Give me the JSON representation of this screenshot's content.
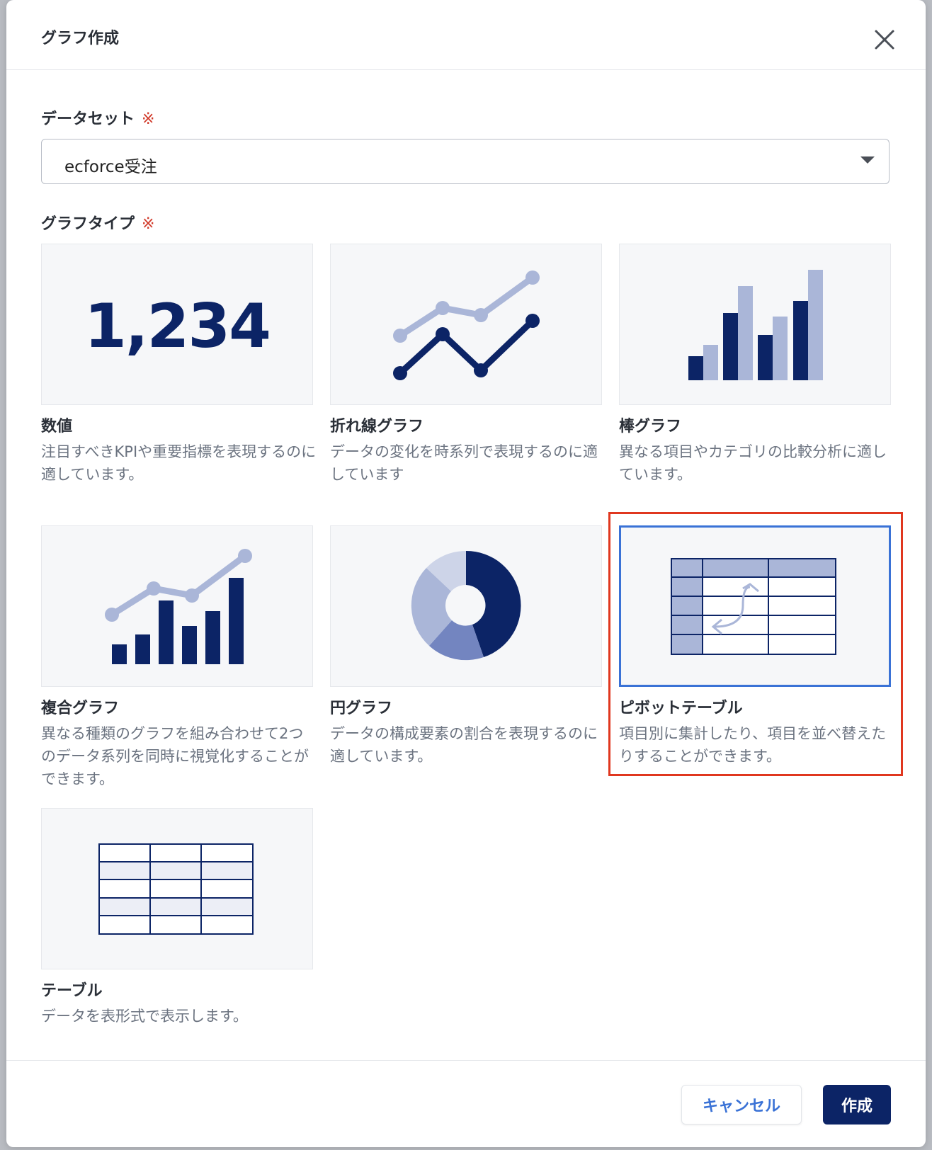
{
  "dialog": {
    "title": "グラフ作成"
  },
  "dataset": {
    "label": "データセット",
    "required_mark": "※",
    "selected_value": "ecforce受注"
  },
  "graph_type": {
    "label": "グラフタイプ",
    "required_mark": "※",
    "selected": "ピボットテーブル",
    "options": [
      {
        "name": "数値",
        "description": "注目すべきKPIや重要指標を表現するのに適しています。",
        "preview_text": "1,234"
      },
      {
        "name": "折れ線グラフ",
        "description": "データの変化を時系列で表現するのに適しています"
      },
      {
        "name": "棒グラフ",
        "description": "異なる項目やカテゴリの比較分析に適しています。"
      },
      {
        "name": "複合グラフ",
        "description": "異なる種類のグラフを組み合わせて2つのデータ系列を同時に視覚化することができます。"
      },
      {
        "name": "円グラフ",
        "description": "データの構成要素の割合を表現するのに適しています。"
      },
      {
        "name": "ピボットテーブル",
        "description": "項目別に集計したり、項目を並べ替えたりすることができます。"
      },
      {
        "name": "テーブル",
        "description": "データを表形式で表示します。"
      }
    ]
  },
  "footer": {
    "cancel_label": "キャンセル",
    "create_label": "作成"
  },
  "colors": {
    "navy": "#0c2466",
    "light_navy": "#aab6d8",
    "accent_blue": "#3a72d6",
    "highlight_red": "#e0371f",
    "required_red": "#d13a2a"
  }
}
